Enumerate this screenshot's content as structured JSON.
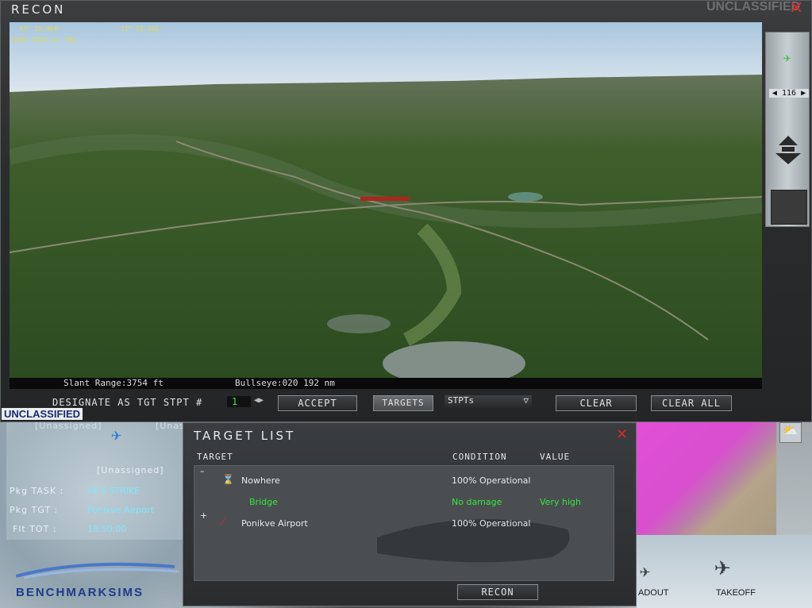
{
  "window": {
    "title": "RECON",
    "classification_top": "UNCLASSIFIED",
    "close_symbol": "✕"
  },
  "hud": {
    "lat": "43° 15.964'",
    "lon": "21° 55.265'",
    "elevation": "ELEV 2526 ft. MSL",
    "slant_range": "Slant Range:3754 ft",
    "bullseye": "Bullseye:020  192 nm"
  },
  "right_strip": {
    "heading": "116",
    "left_arrow": "◀",
    "right_arrow": "▶"
  },
  "controls": {
    "designate_label": "DESIGNATE AS TGT STPT #",
    "stpt_number": "1",
    "accept": "ACCEPT",
    "targets": "TARGETS",
    "stpts": "STPTs",
    "clear": "CLEAR",
    "clear_all": "CLEAR ALL"
  },
  "mission_panel": {
    "classification": "UNCLASSIFIED",
    "unassigned_1": "[Unassigned]",
    "unassigned_2": "[Unassigned]",
    "unassigned_3": "[Unassigned]",
    "pkg_task_label": "Pkg TASK :",
    "pkg_task_value": "OCA STRIKE",
    "pkg_tgt_label": "Pkg TGT  :",
    "pkg_tgt_value": "Ponikve Airport",
    "flt_tot_label": "Flt TOT  :",
    "flt_tot_value": "18:50:00",
    "brand": "BENCHMARKSIMS"
  },
  "target_list": {
    "title": "TARGET LIST",
    "columns": {
      "target": "TARGET",
      "condition": "CONDITION",
      "value": "VALUE"
    },
    "rows": [
      {
        "expander": "–",
        "name": "Nowhere",
        "condition": "100% Operational",
        "value": ""
      },
      {
        "expander": "",
        "name": "Bridge",
        "condition": "No damage",
        "value": "Very high"
      },
      {
        "expander": "+",
        "name": "Ponikve Airport",
        "condition": "100% Operational",
        "value": ""
      }
    ],
    "recon_button": "RECON"
  },
  "bottom_right": {
    "loadout": "ADOUT",
    "takeoff": "TAKEOFF"
  },
  "colors": {
    "hud_text": "#e0dc4a",
    "green_status": "#35e63d",
    "close_red": "#d32b2b",
    "map_magenta": "#e14fd5"
  }
}
